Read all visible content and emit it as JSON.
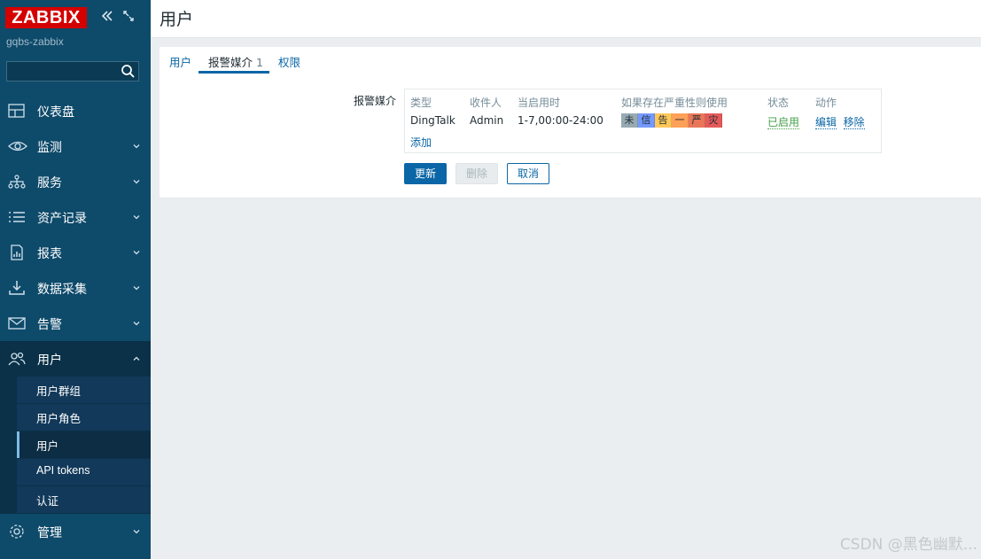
{
  "sidebar": {
    "logo": "ZABBIX",
    "server_name": "gqbs-zabbix",
    "search_placeholder": "",
    "menu": [
      {
        "label": "仪表盘",
        "icon": "dashboard-icon"
      },
      {
        "label": "监测",
        "icon": "eye-icon"
      },
      {
        "label": "服务",
        "icon": "services-icon"
      },
      {
        "label": "资产记录",
        "icon": "list-icon"
      },
      {
        "label": "报表",
        "icon": "report-icon"
      },
      {
        "label": "数据采集",
        "icon": "download-icon"
      },
      {
        "label": "告警",
        "icon": "envelope-icon"
      },
      {
        "label": "用户",
        "icon": "users-icon"
      }
    ],
    "users_submenu": [
      {
        "label": "用户群组"
      },
      {
        "label": "用户角色"
      },
      {
        "label": "用户"
      },
      {
        "label": "API tokens"
      },
      {
        "label": "认证"
      }
    ],
    "admin": {
      "label": "管理",
      "icon": "gear-icon"
    }
  },
  "header": {
    "title": "用户"
  },
  "tabs": [
    {
      "label": "用户"
    },
    {
      "label": "报警媒介",
      "count": "1"
    },
    {
      "label": "权限"
    }
  ],
  "form": {
    "field_label": "报警媒介",
    "columns": [
      "类型",
      "收件人",
      "当启用时",
      "如果存在严重性则使用",
      "状态",
      "动作"
    ],
    "row": {
      "type": "DingTalk",
      "recipient": "Admin",
      "when_active": "1-7,00:00-24:00",
      "severities": [
        {
          "label": "未",
          "color": "#97aab3"
        },
        {
          "label": "信",
          "color": "#7499ff"
        },
        {
          "label": "告",
          "color": "#ffc859"
        },
        {
          "label": "一",
          "color": "#ffa059"
        },
        {
          "label": "严",
          "color": "#e97659"
        },
        {
          "label": "灾",
          "color": "#e45959"
        }
      ],
      "status": "已启用",
      "action_edit": "编辑",
      "action_remove": "移除"
    },
    "add_link": "添加",
    "buttons": {
      "update": "更新",
      "delete": "删除",
      "cancel": "取消"
    }
  },
  "watermark": "CSDN @黑色幽默..."
}
